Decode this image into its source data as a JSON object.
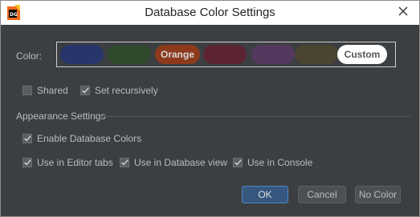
{
  "window": {
    "title": "Database Color Settings"
  },
  "color": {
    "label": "Color:",
    "swatches": [
      {
        "label": "",
        "color": "#28356b",
        "selected": false
      },
      {
        "label": "",
        "color": "#2f4a2c",
        "selected": false
      },
      {
        "label": "Orange",
        "color": "#8d3a1c",
        "selected": false
      },
      {
        "label": "",
        "color": "#5c2332",
        "selected": false
      },
      {
        "label": "",
        "color": "#54385e",
        "selected": false
      },
      {
        "label": "",
        "color": "#4a4431",
        "selected": false
      },
      {
        "label": "Custom",
        "color": "#ffffff",
        "selected": true
      }
    ]
  },
  "options": {
    "shared_label": "Shared",
    "shared_checked": false,
    "recursive_label": "Set recursively",
    "recursive_checked": true
  },
  "appearance": {
    "title": "Appearance Settings",
    "enable_label": "Enable Database Colors",
    "enable_checked": true,
    "editor_tabs_label": "Use in Editor tabs",
    "editor_tabs_checked": true,
    "db_view_label": "Use in Database view",
    "db_view_checked": true,
    "console_label": "Use in Console",
    "console_checked": true
  },
  "buttons": {
    "ok": "OK",
    "cancel": "Cancel",
    "no_color": "No Color"
  }
}
